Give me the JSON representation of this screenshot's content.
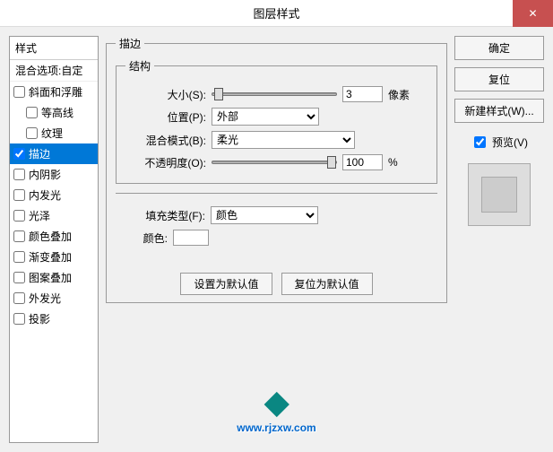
{
  "title": "图层样式",
  "left": {
    "header": "样式",
    "blend": "混合选项:自定",
    "items": [
      {
        "label": "斜面和浮雕",
        "checked": false,
        "indent": false
      },
      {
        "label": "等高线",
        "checked": false,
        "indent": true
      },
      {
        "label": "纹理",
        "checked": false,
        "indent": true
      },
      {
        "label": "描边",
        "checked": true,
        "indent": false,
        "selected": true
      },
      {
        "label": "内阴影",
        "checked": false,
        "indent": false
      },
      {
        "label": "内发光",
        "checked": false,
        "indent": false
      },
      {
        "label": "光泽",
        "checked": false,
        "indent": false
      },
      {
        "label": "颜色叠加",
        "checked": false,
        "indent": false
      },
      {
        "label": "渐变叠加",
        "checked": false,
        "indent": false
      },
      {
        "label": "图案叠加",
        "checked": false,
        "indent": false
      },
      {
        "label": "外发光",
        "checked": false,
        "indent": false
      },
      {
        "label": "投影",
        "checked": false,
        "indent": false
      }
    ]
  },
  "stroke": {
    "legend": "描边",
    "struct_legend": "结构",
    "size_label": "大小(S):",
    "size_value": "3",
    "size_unit": "像素",
    "position_label": "位置(P):",
    "position_value": "外部",
    "blend_label": "混合模式(B):",
    "blend_value": "柔光",
    "opacity_label": "不透明度(O):",
    "opacity_value": "100",
    "opacity_unit": "%",
    "fill_label": "填充类型(F):",
    "fill_value": "颜色",
    "color_label": "颜色:"
  },
  "buttons": {
    "default": "设置为默认值",
    "reset": "复位为默认值"
  },
  "right": {
    "ok": "确定",
    "cancel": "复位",
    "newstyle": "新建样式(W)...",
    "preview": "预览(V)"
  },
  "watermark_url": "www.rjzxw.com"
}
